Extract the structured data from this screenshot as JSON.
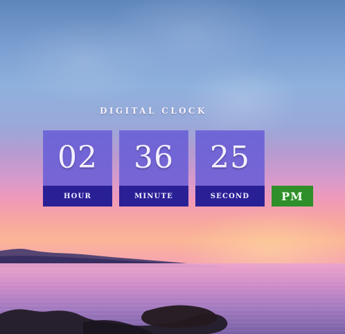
{
  "clock": {
    "title": "DIGITAL CLOCK",
    "hour": {
      "value": "02",
      "label": "HOUR"
    },
    "minute": {
      "value": "36",
      "label": "MINUTE"
    },
    "second": {
      "value": "25",
      "label": "SECOND"
    },
    "period": "PM"
  },
  "theme": {
    "tile_color": "#675CD6",
    "tile_label_color": "#2A2096",
    "period_color": "#2F8F2A"
  }
}
